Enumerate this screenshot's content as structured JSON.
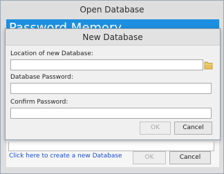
{
  "outer_window": {
    "title": "Open Database",
    "banner_text": "Password Memory",
    "create_link": "Click here to create a new Database",
    "ok_label": "OK",
    "cancel_label": "Cancel"
  },
  "new_database_dialog": {
    "title": "New Database",
    "location_label": "Location of new Database:",
    "location_value": "",
    "password_label": "Database Password:",
    "password_value": "",
    "confirm_label": "Confirm Password:",
    "confirm_value": "",
    "ok_label": "OK",
    "cancel_label": "Cancel"
  },
  "icons": {
    "browse": "folder-icon"
  },
  "colors": {
    "banner": "#1d8fe0",
    "link": "#1a4fd0",
    "folder": "#e8c15a"
  }
}
